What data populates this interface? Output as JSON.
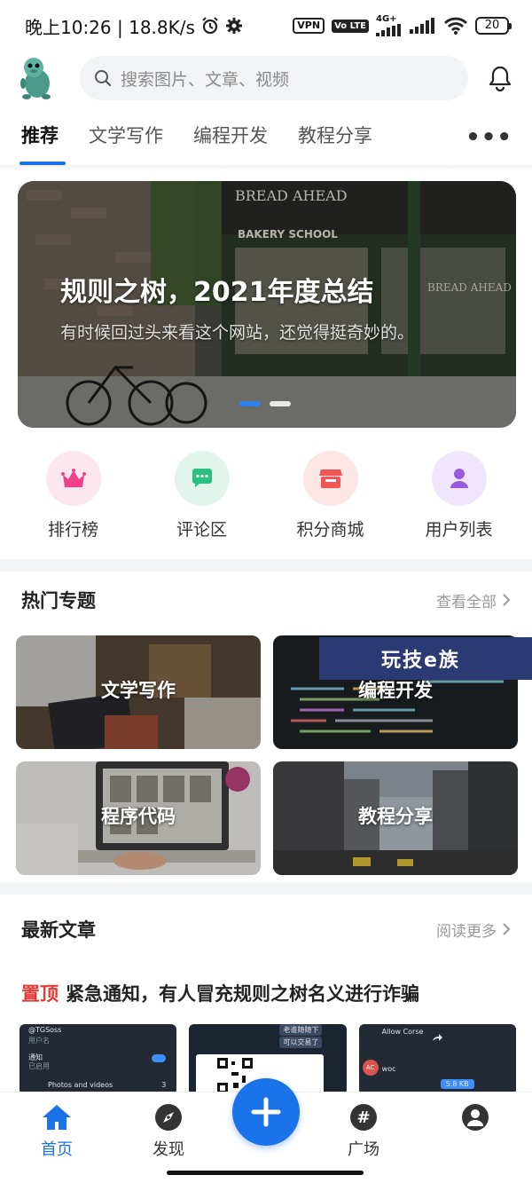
{
  "status_bar": {
    "time_speed": "晚上10:26 | 18.8K/s",
    "vpn": "VPN",
    "volte": "Vo LTE",
    "network": "4G+",
    "battery": "20"
  },
  "header": {
    "search_placeholder": "搜索图片、文章、视频"
  },
  "tabs": [
    "推荐",
    "文学写作",
    "编程开发",
    "教程分享"
  ],
  "tabs_more": "•••",
  "banner": {
    "title": "规则之树，2021年度总结",
    "subtitle": "有时候回过头来看这个网站，还觉得挺奇妙的。",
    "storefront_sign": "BREAD AHEAD",
    "school_sign": "BAKERY SCHOOL",
    "window_sign": "BREAD AHEAD"
  },
  "quick_entries": [
    {
      "label": "排行榜",
      "icon": "crown-icon",
      "bg": "#fde7ef",
      "color": "#f0408a"
    },
    {
      "label": "评论区",
      "icon": "chat-icon",
      "bg": "#e2f5ec",
      "color": "#2bbf83"
    },
    {
      "label": "积分商城",
      "icon": "store-icon",
      "bg": "#fde6e6",
      "color": "#f25555"
    },
    {
      "label": "用户列表",
      "icon": "user-icon",
      "bg": "#efe6fb",
      "color": "#9b59e0"
    }
  ],
  "hot_topics": {
    "title": "热门专题",
    "link": "查看全部",
    "items": [
      "文学写作",
      "编程开发",
      "程序代码",
      "教程分享"
    ]
  },
  "watermark": "玩技e族",
  "latest": {
    "title": "最新文章",
    "link": "阅读更多",
    "pinned_tag": "置顶",
    "pinned_title": "紧急通知，有人冒充规则之树名义进行诈骗"
  },
  "thumb_texts": {
    "t1_user": "@TGSoss",
    "t1_sub": "用户名",
    "t1_row1": "通知",
    "t1_row1_sub": "已启用",
    "t1_row2": "Photos and videos",
    "t1_row2_count": "3",
    "t2_msg1": "老谁随随下",
    "t2_msg2": "可以交易了",
    "t3_user": "Allow Corse",
    "t3_name": "AC",
    "t3_msg": "woc",
    "t3_size": "5.8 KB"
  },
  "bottom_nav": [
    "首页",
    "发现",
    "广场"
  ],
  "colors": {
    "accent": "#1a73e8",
    "pinned": "#e53935"
  }
}
